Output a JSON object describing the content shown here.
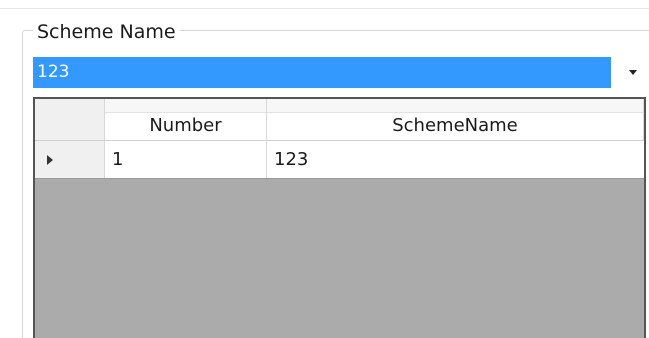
{
  "groupbox": {
    "label": "Scheme Name"
  },
  "scheme_combo": {
    "value": "123",
    "arrow_icon": "dropdown-arrow-icon"
  },
  "grid": {
    "columns": [
      "Number",
      "SchemeName"
    ],
    "rows": [
      {
        "number": "1",
        "scheme_name": "123",
        "current": true
      }
    ]
  },
  "colors": {
    "selection": "#3399ff",
    "grid_background": "#ababab"
  }
}
